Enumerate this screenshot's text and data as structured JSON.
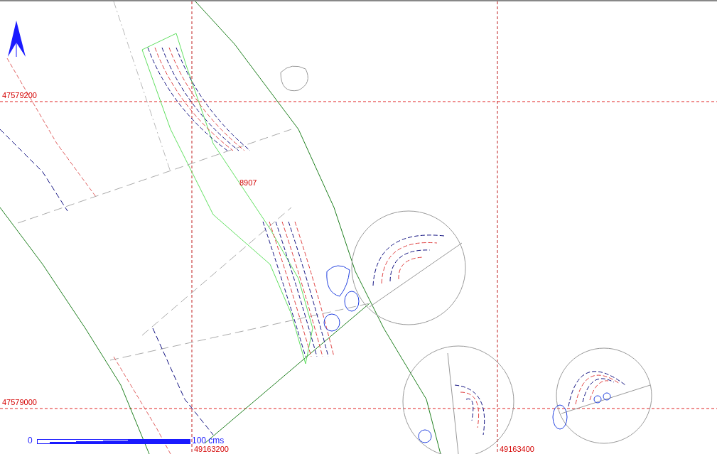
{
  "map": {
    "northings": [
      "47579200",
      "47579000"
    ],
    "eastings": [
      "49163200",
      "49163400"
    ],
    "parcel_label": "8907",
    "scale_bar": {
      "start": "0",
      "end": "100 cms"
    }
  }
}
